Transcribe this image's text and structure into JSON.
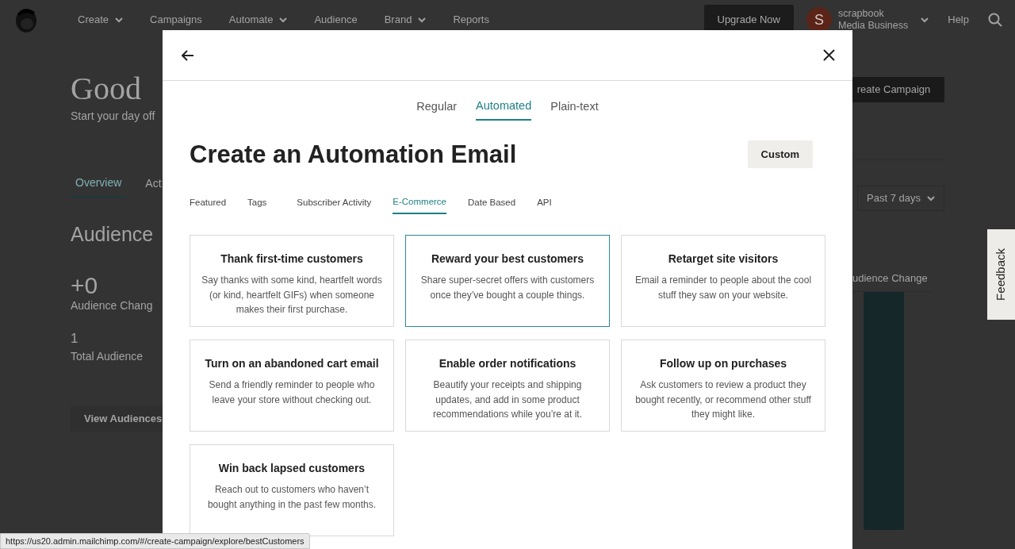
{
  "nav": {
    "items": [
      {
        "label": "Create",
        "dropdown": true
      },
      {
        "label": "Campaigns",
        "dropdown": false
      },
      {
        "label": "Automate",
        "dropdown": true
      },
      {
        "label": "Audience",
        "dropdown": false
      },
      {
        "label": "Brand",
        "dropdown": true
      },
      {
        "label": "Reports",
        "dropdown": false
      }
    ],
    "upgrade_button": "Upgrade Now",
    "avatar_letter": "S",
    "account": {
      "name": "scrapbook",
      "plan": "Media Business"
    },
    "help": "Help"
  },
  "background": {
    "greeting": "Good",
    "subtitle": "Start your day off",
    "tabs": [
      {
        "label": "Overview",
        "selected": true
      },
      {
        "label": "Act",
        "selected": false
      }
    ],
    "section_title": "Audience",
    "change_value": "+0",
    "change_label": "Audience Chang",
    "total_value": "1",
    "total_label": "Total Audience",
    "view_button": "View Audiences",
    "create_button": "reate Campaign",
    "period_select": "Past 7 days",
    "chart_label": "udience Change",
    "feedback": "Feedback"
  },
  "modal": {
    "tabs": [
      {
        "label": "Regular",
        "selected": false
      },
      {
        "label": "Automated",
        "selected": true
      },
      {
        "label": "Plain-text",
        "selected": false
      }
    ],
    "title": "Create an Automation Email",
    "custom_button": "Custom",
    "categories": [
      {
        "label": "Featured",
        "selected": false
      },
      {
        "label": "Tags",
        "selected": false
      },
      {
        "label": "Subscriber Activity",
        "selected": false
      },
      {
        "label": "E-Commerce",
        "selected": true
      },
      {
        "label": "Date Based",
        "selected": false
      },
      {
        "label": "API",
        "selected": false
      }
    ],
    "cards": [
      {
        "title": "Thank first-time customers",
        "text": "Say thanks with some kind, heartfelt words (or kind, heartfelt GIFs) when someone makes their first purchase.",
        "selected": false
      },
      {
        "title": "Reward your best customers",
        "text": "Share super-secret offers with customers once they’ve bought a couple things.",
        "selected": true
      },
      {
        "title": "Retarget site visitors",
        "text": "Email a reminder to people about the cool stuff they saw on your website.",
        "selected": false
      },
      {
        "title": "Turn on an abandoned cart email",
        "text": "Send a friendly reminder to people who leave your store without checking out.",
        "selected": false
      },
      {
        "title": "Enable order notifications",
        "text": "Beautify your receipts and shipping updates, and add in some product recommendations while you’re at it.",
        "selected": false
      },
      {
        "title": "Follow up on purchases",
        "text": "Ask customers to review a product they bought recently, or recommend other stuff they might like.",
        "selected": false
      },
      {
        "title": "Win back lapsed customers",
        "text": "Reach out to customers who haven’t bought anything in the past few months.",
        "selected": false
      }
    ]
  },
  "status_url": "https://us20.admin.mailchimp.com/#/create-campaign/explore/bestCustomers"
}
